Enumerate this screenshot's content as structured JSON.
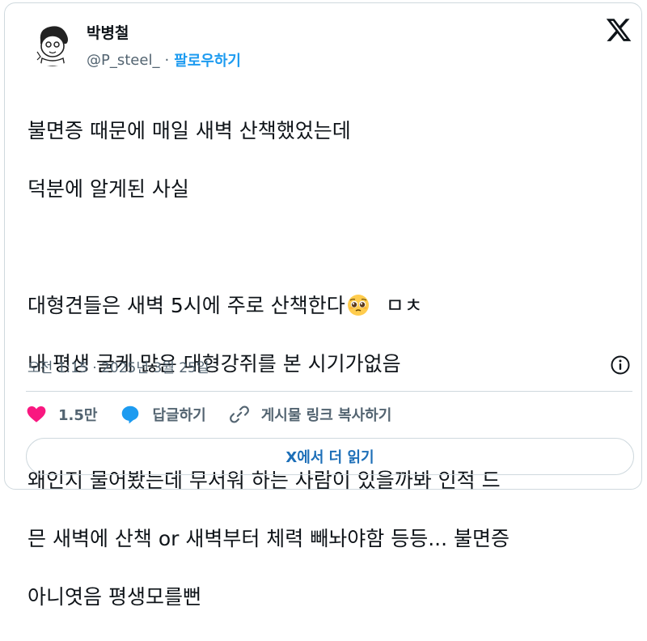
{
  "author": {
    "name": "박병철",
    "handle": "@P_steel_",
    "separator": "·",
    "follow_label": "팔로우하기"
  },
  "tweet": {
    "lines": [
      "불면증 때문에 매일 새벽 산책했었는데",
      "덕분에 알게된 사실",
      "",
      "대형견들은 새벽 5시에 주로 산책한다",
      "내 평생 글케 많은 대형강쥐를 본 시기가없음",
      "",
      "왜인지 물어봤는데 무서워 하는 사람이 있을까봐 인적 드",
      "믄 새벽에 산책 or 새벽부터 체력 빼놔야함 등등... 불면증",
      "아니엿음 평생모를뻔"
    ],
    "line4_suffix": "ㅁㅊ",
    "emoji": "pleading-face-icon",
    "timestamp": "오전 1:15 · 2025년 3월 25일"
  },
  "actions": {
    "like_count": "1.5만",
    "reply_label": "답글하기",
    "copy_link_label": "게시물 링크 복사하기"
  },
  "read_more_label": "X에서 더 읽기",
  "colors": {
    "like": "#f91880",
    "reply": "#1d9bf0",
    "link": "#1d9bf0",
    "text": "#0f1419",
    "muted": "#536471"
  }
}
